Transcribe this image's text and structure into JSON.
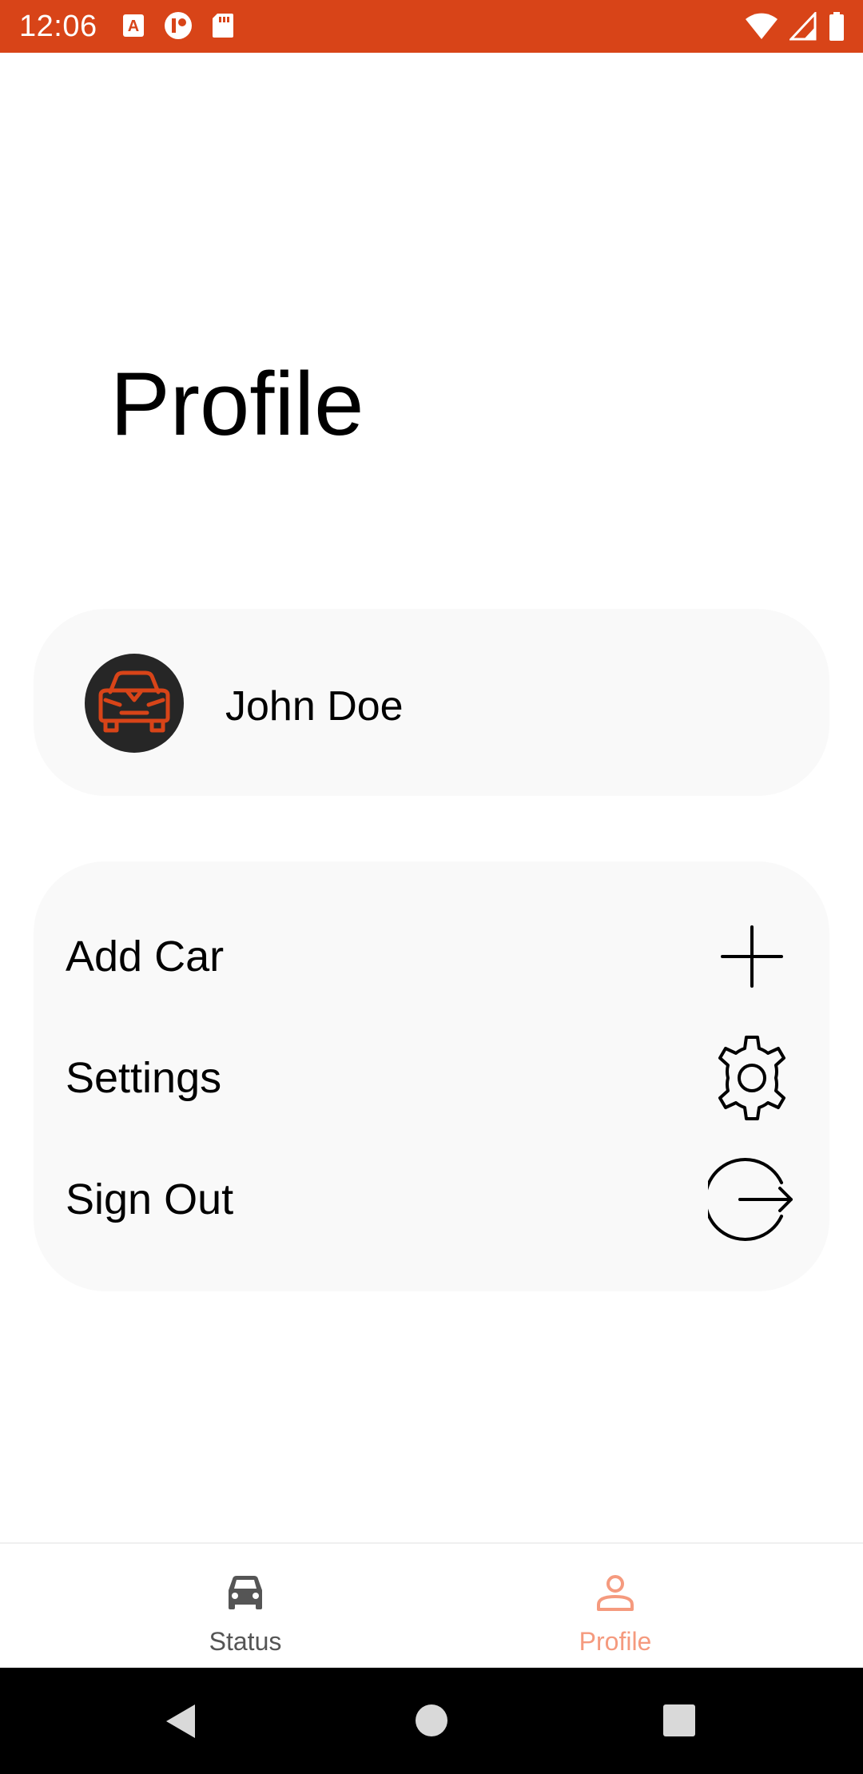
{
  "status_bar": {
    "time": "12:06",
    "left_icons": [
      "autofill-icon",
      "notification-icon",
      "sd-card-icon"
    ],
    "right_icons": [
      "wifi-icon",
      "signal-icon",
      "battery-icon"
    ],
    "color": "#d84418"
  },
  "page": {
    "title": "Profile"
  },
  "profile_card": {
    "avatar_icon": "car-front-icon",
    "user_name": "John Doe"
  },
  "menu": {
    "items": [
      {
        "label": "Add Car",
        "icon": "plus-icon"
      },
      {
        "label": "Settings",
        "icon": "gear-icon"
      },
      {
        "label": "Sign Out",
        "icon": "sign-out-icon"
      }
    ]
  },
  "bottom_nav": {
    "tabs": [
      {
        "label": "Status",
        "icon": "car-icon",
        "active": false
      },
      {
        "label": "Profile",
        "icon": "person-icon",
        "active": true
      }
    ],
    "active_color": "#f59a7e",
    "inactive_color": "#555555"
  },
  "system_nav": {
    "buttons": [
      "back-icon",
      "home-icon",
      "recents-icon"
    ]
  }
}
